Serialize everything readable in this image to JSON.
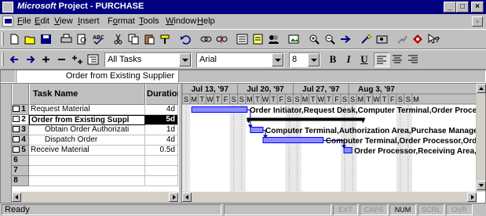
{
  "window": {
    "title_brand": "Microsoft",
    "title_rest": " Project - PURCHASE",
    "controls": {
      "minimize": "_",
      "maximize": "□",
      "close": "×"
    }
  },
  "menu": {
    "items": [
      {
        "pre": "",
        "key": "F",
        "post": "ile"
      },
      {
        "pre": "",
        "key": "E",
        "post": "dit"
      },
      {
        "pre": "",
        "key": "V",
        "post": "iew"
      },
      {
        "pre": "",
        "key": "I",
        "post": "nsert"
      },
      {
        "pre": "F",
        "key": "o",
        "post": "rmat"
      },
      {
        "pre": "",
        "key": "T",
        "post": "ools"
      },
      {
        "pre": "",
        "key": "W",
        "post": "indow"
      },
      {
        "pre": "",
        "key": "H",
        "post": "elp"
      }
    ],
    "doc_restore": "▫"
  },
  "formatting": {
    "filter_value": "All Tasks",
    "font_value": "Arial",
    "size_value": "8",
    "bold": "B",
    "italic": "I",
    "underline": "U"
  },
  "entry_bar": {
    "value": "Order from Existing Supplier"
  },
  "table": {
    "headers": {
      "name": "Task Name",
      "duration": "Duration"
    },
    "rows": [
      {
        "id": "1",
        "name": "Request Material",
        "duration": "4d",
        "indent": 0,
        "summary": false
      },
      {
        "id": "2",
        "name": "Order from Existing Suppl",
        "duration": "5d",
        "indent": 0,
        "summary": true
      },
      {
        "id": "3",
        "name": "Obtain Order Authorizati",
        "duration": "1d",
        "indent": 1,
        "summary": false
      },
      {
        "id": "4",
        "name": "Dispatch Order",
        "duration": "4d",
        "indent": 1,
        "summary": false
      },
      {
        "id": "5",
        "name": "Receive Material",
        "duration": "0.5d",
        "indent": 0,
        "summary": false
      },
      {
        "id": "6",
        "name": "",
        "duration": "",
        "indent": 0,
        "summary": false
      },
      {
        "id": "7",
        "name": "",
        "duration": "",
        "indent": 0,
        "summary": false
      },
      {
        "id": "8",
        "name": "",
        "duration": "",
        "indent": 0,
        "summary": false
      }
    ]
  },
  "gantt": {
    "weeks": [
      "Jul 13, '97",
      "Jul 20, '97",
      "Jul 27, '97",
      "Aug 3, '97"
    ],
    "day_letters": [
      "S",
      "M",
      "T",
      "W",
      "T",
      "F",
      "S"
    ],
    "bars": [
      {
        "row": 0,
        "start_day": 1.2,
        "end_day": 8.2,
        "type": "task",
        "label": "Order Initiator,Request Desk,Computer Terminal,Order Processor"
      },
      {
        "row": 1,
        "start_day": 8.2,
        "end_day": 23.0,
        "type": "summary",
        "label": ""
      },
      {
        "row": 2,
        "start_day": 8.6,
        "end_day": 10.2,
        "type": "task",
        "label": "Computer Terminal,Authorization Area,Purchase Manager"
      },
      {
        "row": 3,
        "start_day": 10.2,
        "end_day": 17.8,
        "type": "task",
        "label": "Computer Terminal,Order Processor,Order Des"
      },
      {
        "row": 4,
        "start_day": 20.4,
        "end_day": 21.4,
        "type": "task",
        "label": "Order Processor,Receiving Area,Computer Te"
      }
    ],
    "colors": {
      "bar_fill": "#8c8cff",
      "bar_border": "#0000ff",
      "summary": "#000000",
      "link": "#000080",
      "weekend": "#c0c0c0",
      "grid": "#000000"
    }
  },
  "status": {
    "text": "Ready",
    "indicators": [
      {
        "label": "EXT",
        "on": false
      },
      {
        "label": "CAPS",
        "on": false
      },
      {
        "label": "NUM",
        "on": true
      },
      {
        "label": "SCRL",
        "on": false
      },
      {
        "label": "OVR",
        "on": false
      }
    ]
  }
}
